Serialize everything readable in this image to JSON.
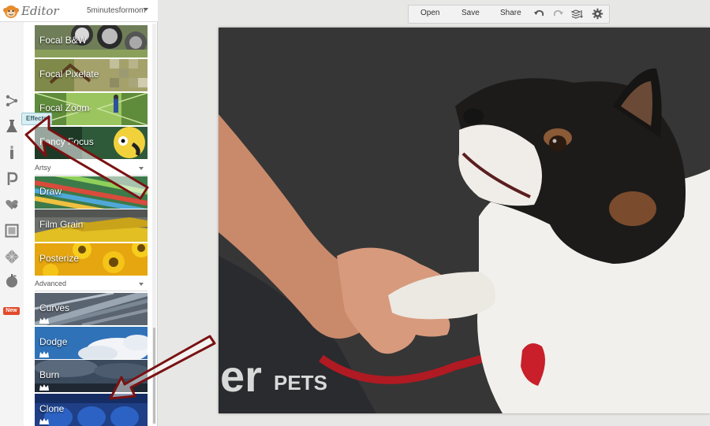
{
  "app": {
    "logo_text": "Editor",
    "account_name": "5minutesformom"
  },
  "rail": {
    "items": [
      {
        "icon": "basic-edits-icon"
      },
      {
        "icon": "effects-icon",
        "tooltip": "Effects"
      },
      {
        "icon": "touch-up-icon"
      },
      {
        "icon": "text-icon"
      },
      {
        "icon": "overlays-icon"
      },
      {
        "icon": "frames-icon"
      },
      {
        "icon": "textures-icon"
      },
      {
        "icon": "seasonal-icon",
        "badge": "New"
      }
    ]
  },
  "panel": {
    "tiles_top": [
      {
        "label": "Focal B&W"
      },
      {
        "label": "Focal Pixelate"
      },
      {
        "label": "Focal Zoom"
      },
      {
        "label": "Fancy Focus"
      }
    ],
    "section_artsy": "Artsy",
    "tiles_artsy": [
      {
        "label": "Draw"
      },
      {
        "label": "Film Grain"
      },
      {
        "label": "Posterize"
      }
    ],
    "section_advanced": "Advanced",
    "tiles_advanced": [
      {
        "label": "Curves"
      },
      {
        "label": "Dodge"
      },
      {
        "label": "Burn"
      },
      {
        "label": "Clone"
      }
    ]
  },
  "toolbar": {
    "open_label": "Open",
    "save_label": "Save",
    "share_label": "Share"
  },
  "photo": {
    "shirt_text": "er",
    "shirt_subtext": "PETS"
  },
  "colors": {
    "annotation_arrow": "#7a1212",
    "new_badge": "#e14a2c",
    "tooltip_bg": "#d9eef3"
  }
}
